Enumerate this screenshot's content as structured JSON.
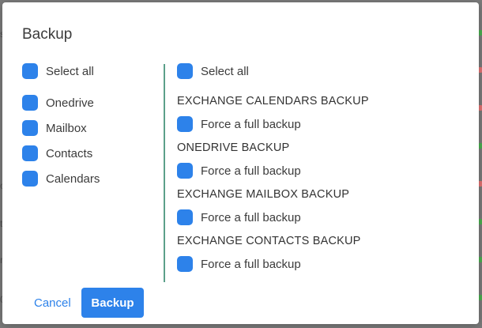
{
  "backdrop": {
    "fragments": [
      "s",
      "o",
      "t",
      "r",
      "0"
    ]
  },
  "dialog": {
    "title": "Backup",
    "left_panel": {
      "select_all": "Select all",
      "items": [
        {
          "label": "Onedrive",
          "checked": true
        },
        {
          "label": "Mailbox",
          "checked": true
        },
        {
          "label": "Contacts",
          "checked": true
        },
        {
          "label": "Calendars",
          "checked": true
        }
      ]
    },
    "right_panel": {
      "select_all": "Select all",
      "sections": [
        {
          "heading": "EXCHANGE CALENDARS BACKUP",
          "option": "Force a full backup",
          "checked": true
        },
        {
          "heading": "ONEDRIVE BACKUP",
          "option": "Force a full backup",
          "checked": true
        },
        {
          "heading": "EXCHANGE MAILBOX BACKUP",
          "option": "Force a full backup",
          "checked": true
        },
        {
          "heading": "EXCHANGE CONTACTS BACKUP",
          "option": "Force a full backup",
          "checked": true
        }
      ]
    },
    "actions": {
      "cancel_label": "Cancel",
      "backup_label": "Backup"
    }
  },
  "colors": {
    "accent": "#2d82ea",
    "divider": "#5ba08a",
    "overlay": "#7b7b7b"
  }
}
